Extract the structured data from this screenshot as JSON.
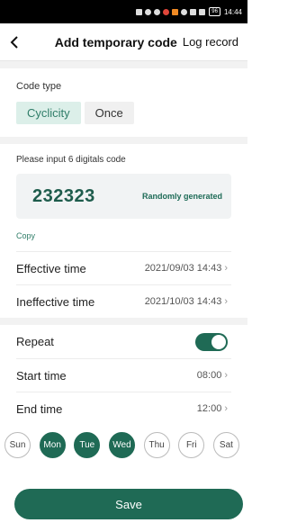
{
  "statusbar": {
    "time": "14:44",
    "battery": "96"
  },
  "header": {
    "title": "Add temporary code",
    "log_record": "Log record"
  },
  "code_type": {
    "label": "Code type",
    "options": [
      "Cyclicity",
      "Once"
    ],
    "selected": "Cyclicity"
  },
  "code": {
    "label": "Please input 6 digitals code",
    "value": "232323",
    "random_label": "Randomly generated",
    "copy_label": "Copy"
  },
  "effective": {
    "label": "Effective time",
    "value": "2021/09/03 14:43"
  },
  "ineffective": {
    "label": "Ineffective time",
    "value": "2021/10/03 14:43"
  },
  "repeat": {
    "label": "Repeat",
    "enabled": true
  },
  "start": {
    "label": "Start time",
    "value": "08:00"
  },
  "end": {
    "label": "End time",
    "value": "12:00"
  },
  "days": [
    {
      "label": "Sun",
      "on": false
    },
    {
      "label": "Mon",
      "on": true
    },
    {
      "label": "Tue",
      "on": true
    },
    {
      "label": "Wed",
      "on": true
    },
    {
      "label": "Thu",
      "on": false
    },
    {
      "label": "Fri",
      "on": false
    },
    {
      "label": "Sat",
      "on": false
    }
  ],
  "save_label": "Save",
  "colors": {
    "accent": "#1f6a55",
    "accent_light": "#dcefe9"
  }
}
